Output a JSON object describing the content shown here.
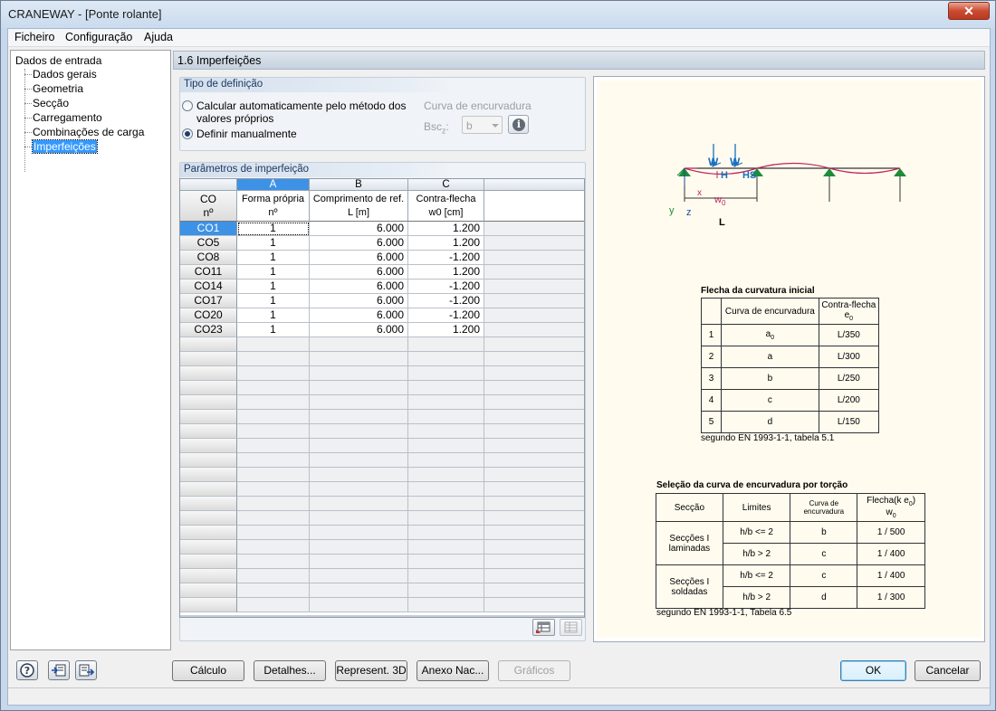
{
  "window": {
    "title": "CRANEWAY - [Ponte rolante]",
    "close_label": "✕"
  },
  "menu": {
    "items": [
      "Ficheiro",
      "Configuração",
      "Ajuda"
    ]
  },
  "tree": {
    "root": "Dados de entrada",
    "items": [
      "Dados gerais",
      "Geometria",
      "Secção",
      "Carregamento",
      "Combinações de carga",
      "Imperfeições"
    ],
    "selected_index": 5
  },
  "panel": {
    "title": "1.6 Imperfeições"
  },
  "definition": {
    "group_title": "Tipo de definição",
    "option_auto_line1": "Calcular automaticamente pelo método dos",
    "option_auto_line2": "valores próprios",
    "option_manual": "Definir manualmente",
    "selected": "manual",
    "curve_label": "Curva de encurvadura",
    "bsc_label": "Bsc",
    "bsc_sub": "z",
    "bsc_colon": ":",
    "bsc_value": "b"
  },
  "params": {
    "group_title": "Parâmetros de imperfeição",
    "col_letters": [
      "A",
      "B",
      "C"
    ],
    "row_header_line1": "CO",
    "row_header_line2": "nº",
    "col_heads": [
      {
        "line1": "Forma própria",
        "line2": "nº"
      },
      {
        "line1": "Comprimento de ref.",
        "line2": "L [m]"
      },
      {
        "line1": "Contra-flecha",
        "line2": "w0 [cm]"
      }
    ],
    "rows": [
      {
        "co": "CO1",
        "a": "1",
        "b": "6.000",
        "c": "1.200"
      },
      {
        "co": "CO5",
        "a": "1",
        "b": "6.000",
        "c": "1.200"
      },
      {
        "co": "CO8",
        "a": "1",
        "b": "6.000",
        "c": "-1.200"
      },
      {
        "co": "CO11",
        "a": "1",
        "b": "6.000",
        "c": "1.200"
      },
      {
        "co": "CO14",
        "a": "1",
        "b": "6.000",
        "c": "-1.200"
      },
      {
        "co": "CO17",
        "a": "1",
        "b": "6.000",
        "c": "-1.200"
      },
      {
        "co": "CO20",
        "a": "1",
        "b": "6.000",
        "c": "-1.200"
      },
      {
        "co": "CO23",
        "a": "1",
        "b": "6.000",
        "c": "1.200"
      }
    ]
  },
  "diagram": {
    "w1": "W",
    "w2": "W",
    "h": "H",
    "hs": "HS",
    "x": "x",
    "w0": "w",
    "w0_sub": "0",
    "y": "y",
    "z": "z",
    "l": "L"
  },
  "flecha_table": {
    "title": "Flecha da curvatura inicial",
    "head_curve": "Curva de encurvadura",
    "head_contra_line1": "Contra-flecha",
    "head_contra_line2": "e",
    "head_contra_sub": "0",
    "rows": [
      {
        "n": "1",
        "curve": "a",
        "curve_sub": "0",
        "value": "L/350"
      },
      {
        "n": "2",
        "curve": "a",
        "curve_sub": "",
        "value": "L/300"
      },
      {
        "n": "3",
        "curve": "b",
        "curve_sub": "",
        "value": "L/250"
      },
      {
        "n": "4",
        "curve": "c",
        "curve_sub": "",
        "value": "L/200"
      },
      {
        "n": "5",
        "curve": "d",
        "curve_sub": "",
        "value": "L/150"
      }
    ],
    "note": "segundo EN 1993-1-1, tabela 5.1"
  },
  "torsion_table": {
    "title": "Seleção da curva de encurvadura por torção",
    "head_seccao": "Secção",
    "head_limites": "Limites",
    "head_curva_line1": "Curva de",
    "head_curva_line2": "encurvadura",
    "head_flecha_line1": "Flecha(k e",
    "head_flecha_sub1": "0",
    "head_flecha_close": ")",
    "head_flecha_line2": "w",
    "head_flecha_sub2": "0",
    "group1_line1": "Secções I",
    "group1_line2": "laminadas",
    "group2_line1": "Secções I",
    "group2_line2": "soldadas",
    "rows": [
      {
        "limit": "h/b <= 2",
        "curve": "b",
        "value": "1 / 500"
      },
      {
        "limit": "h/b > 2",
        "curve": "c",
        "value": "1 / 400"
      },
      {
        "limit": "h/b <= 2",
        "curve": "c",
        "value": "1 / 400"
      },
      {
        "limit": "h/b > 2",
        "curve": "d",
        "value": "1 / 300"
      }
    ],
    "note": "segundo EN 1993-1-1, Tabela 6.5"
  },
  "buttons": {
    "calculo": "Cálculo",
    "detalhes": "Detalhes...",
    "represent": "Represent. 3D",
    "anexo": "Anexo Nac...",
    "graficos": "Gráficos",
    "ok": "OK",
    "cancelar": "Cancelar"
  },
  "icons": {
    "help": "help-icon",
    "import": "import-icon",
    "export": "export-icon",
    "info": "info-icon"
  },
  "colors": {
    "accent": "#3d92e6",
    "support": "#1e8c3a",
    "load": "#1a6fc0",
    "curve": "#c0245a"
  }
}
